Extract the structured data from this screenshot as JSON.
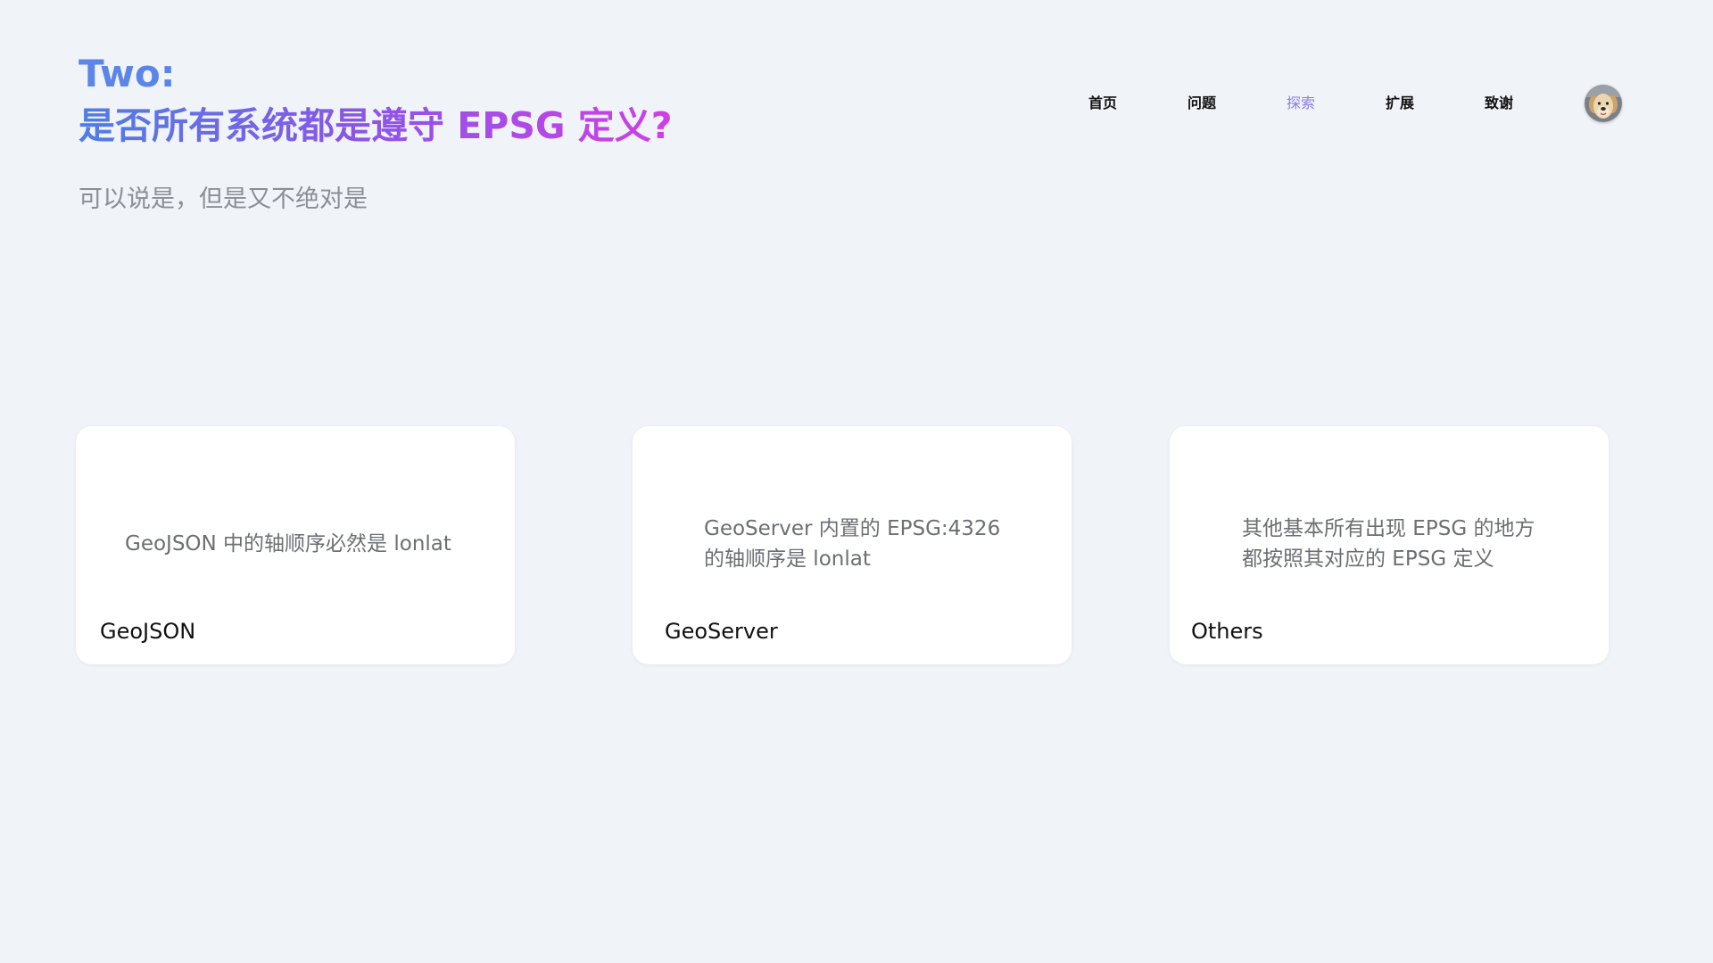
{
  "header": {
    "title_line1": "Two:",
    "title_line2": "是否所有系统都是遵守 EPSG 定义?",
    "subtitle": "可以说是，但是又不绝对是"
  },
  "nav": {
    "items": [
      {
        "label": "首页",
        "active": false
      },
      {
        "label": "问题",
        "active": false
      },
      {
        "label": "探索",
        "active": true
      },
      {
        "label": "扩展",
        "active": false
      },
      {
        "label": "致谢",
        "active": false
      }
    ],
    "avatar_icon": "dog-avatar-icon"
  },
  "cards": [
    {
      "body": "GeoJSON 中的轴顺序必然是 lonlat",
      "label": "GeoJSON"
    },
    {
      "body": "GeoServer 内置的 EPSG:4326\n的轴顺序是 lonlat",
      "label": "GeoServer"
    },
    {
      "body": "其他基本所有出现 EPSG 的地方\n都按照其对应的 EPSG 定义",
      "label": "Others"
    }
  ],
  "colors": {
    "background": "#f0f3f8",
    "title_blue": "#5b86e8",
    "title_gradient_end": "#d13ee6",
    "nav_active": "#8b7be6"
  }
}
